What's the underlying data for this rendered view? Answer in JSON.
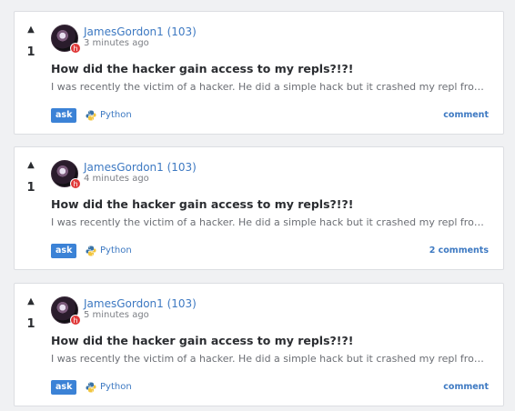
{
  "posts": [
    {
      "upvote_icon": "up-arrow-icon",
      "votes": "1",
      "avatar_badge": "h",
      "username": "JamesGordon1 (103)",
      "time": "3 minutes ago",
      "title": "How did the hacker gain access to my repls?!?!",
      "preview": "I was recently the victim of a hacker. He did a simple hack but it crashed my repl from working",
      "tag": "ask",
      "language_icon": "python-icon",
      "language": "Python",
      "comments": "comment"
    },
    {
      "upvote_icon": "up-arrow-icon",
      "votes": "1",
      "avatar_badge": "h",
      "username": "JamesGordon1 (103)",
      "time": "4 minutes ago",
      "title": "How did the hacker gain access to my repls?!?!",
      "preview": "I was recently the victim of a hacker. He did a simple hack but it crashed my repl from working",
      "tag": "ask",
      "language_icon": "python-icon",
      "language": "Python",
      "comments": "2 comments"
    },
    {
      "upvote_icon": "up-arrow-icon",
      "votes": "1",
      "avatar_badge": "h",
      "username": "JamesGordon1 (103)",
      "time": "5 minutes ago",
      "title": "How did the hacker gain access to my repls?!?!",
      "preview": "I was recently the victim of a hacker. He did a simple hack but it crashed my repl from working",
      "tag": "ask",
      "language_icon": "python-icon",
      "language": "Python",
      "comments": "comment"
    }
  ],
  "colors": {
    "link": "#3d79c2",
    "tag_background": "#3b82d6",
    "badge": "#e03a3a"
  }
}
